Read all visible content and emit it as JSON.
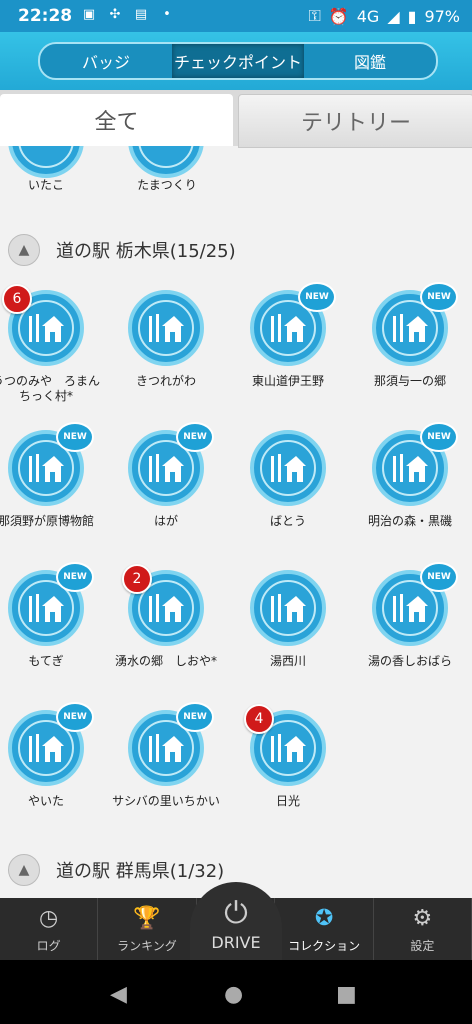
{
  "status_bar": {
    "time": "22:28",
    "network": "4G",
    "battery": "97%"
  },
  "header": {
    "segments": [
      "バッジ",
      "チェックポイント",
      "図鑑"
    ],
    "active_segment": 1
  },
  "tabs": {
    "all": "全て",
    "territory": "テリトリー"
  },
  "top_items": [
    {
      "label": "いたこ"
    },
    {
      "label": "たまつくり"
    }
  ],
  "sections": [
    {
      "title": "道の駅 栃木県(15/25)"
    },
    {
      "title": "道の駅 群馬県(1/32)"
    }
  ],
  "items": [
    {
      "label": "うつのみや　ろまんちっく村*",
      "new_text": "",
      "count": "6"
    },
    {
      "label": "きつれがわ",
      "new_text": "",
      "count": ""
    },
    {
      "label": "東山道伊王野",
      "new_text": "NEW",
      "count": ""
    },
    {
      "label": "那須与一の郷",
      "new_text": "NEW",
      "count": ""
    },
    {
      "label": "那須野が原博物館",
      "new_text": "NEW",
      "count": ""
    },
    {
      "label": "はが",
      "new_text": "NEW",
      "count": ""
    },
    {
      "label": "ばとう",
      "new_text": "",
      "count": ""
    },
    {
      "label": "明治の森・黒磯",
      "new_text": "NEW",
      "count": ""
    },
    {
      "label": "もてぎ",
      "new_text": "NEW",
      "count": ""
    },
    {
      "label": "湧水の郷　しおや*",
      "new_text": "",
      "count": "2"
    },
    {
      "label": "湯西川",
      "new_text": "",
      "count": ""
    },
    {
      "label": "湯の香しおばら",
      "new_text": "NEW",
      "count": ""
    },
    {
      "label": "やいた",
      "new_text": "NEW",
      "count": ""
    },
    {
      "label": "サシバの里いちかい",
      "new_text": "NEW",
      "count": ""
    },
    {
      "label": "日光",
      "new_text": "",
      "count": "4"
    }
  ],
  "bottom_nav": {
    "log": "ログ",
    "ranking": "ランキング",
    "drive": "DRIVE",
    "collection": "コレクション",
    "settings": "設定"
  },
  "colors": {
    "accent": "#23a9d6",
    "badge": "#d01a1a"
  }
}
